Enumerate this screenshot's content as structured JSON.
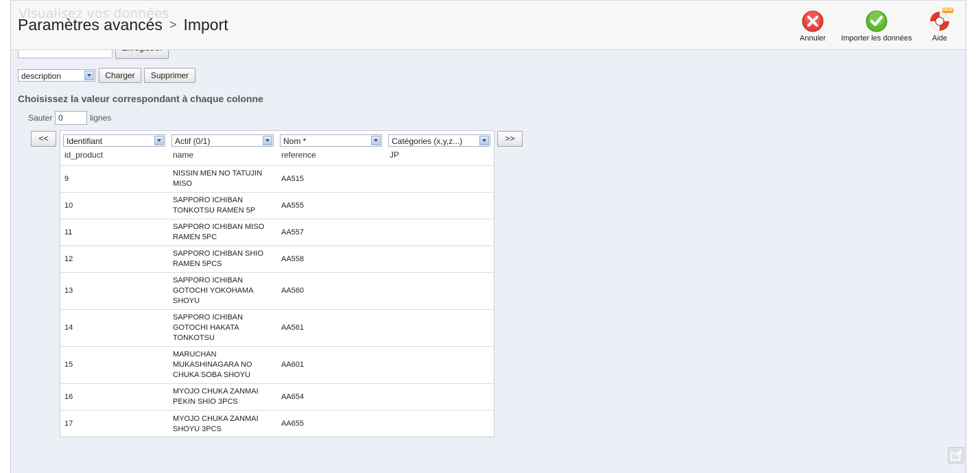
{
  "header": {
    "ghost_title": "Visualisez vos données",
    "ghost_subtitle": "",
    "breadcrumb_parent": "Paramètres avancés",
    "breadcrumb_separator": ">",
    "breadcrumb_current": "Import"
  },
  "toolbar": {
    "cancel_label": "Annuler",
    "import_label": "Importer les données",
    "help_label": "Aide",
    "help_badge": "NEW"
  },
  "save_config": {
    "name_value": "",
    "save_label": "Enregistrer"
  },
  "config_select": {
    "selected": "description",
    "load_label": "Charger",
    "delete_label": "Supprimer"
  },
  "mapping": {
    "heading": "Choisissez la valeur correspondant à chaque colonne",
    "skip_label": "Sauter",
    "skip_value": "0",
    "lines_label": "lignes",
    "prev_label": "<<",
    "next_label": ">>",
    "column_selects": [
      "Identifiant",
      "Actif (0/1)",
      "Nom *",
      "Catégories (x,y,z...)"
    ],
    "column_headers": [
      "id_product",
      "name",
      "reference",
      "JP"
    ],
    "rows": [
      [
        "9",
        "NISSIN MEN NO TATUJIN MISO",
        "AA515",
        ""
      ],
      [
        "10",
        "SAPPORO ICHIBAN TONKOTSU RAMEN 5P",
        "AA555",
        ""
      ],
      [
        "11",
        "SAPPORO ICHIBAN MISO RAMEN 5PC",
        "AA557",
        ""
      ],
      [
        "12",
        "SAPPORO ICHIBAN SHIO RAMEN 5PCS",
        "AA558",
        ""
      ],
      [
        "13",
        "SAPPORO ICHIBAN GOTOCHI YOKOHAMA SHOYU",
        "AA560",
        ""
      ],
      [
        "14",
        "SAPPORO ICHIBAN GOTOCHI HAKATA TONKOTSU",
        "AA561",
        ""
      ],
      [
        "15",
        "MARUCHAN MUKASHINAGARA NO CHUKA SOBA SHOYU",
        "AA601",
        ""
      ],
      [
        "16",
        "MYOJO CHUKA ZANMAI PEKIN SHIO 3PCS",
        "AA654",
        ""
      ],
      [
        "17",
        "MYOJO CHUKA ZANMAI SHOYU 3PCS",
        "AA655",
        ""
      ]
    ]
  },
  "colors": {
    "cancel": "#e8403a",
    "import": "#5cb82e",
    "help": "#e03b2f",
    "background": "#eceff5"
  }
}
